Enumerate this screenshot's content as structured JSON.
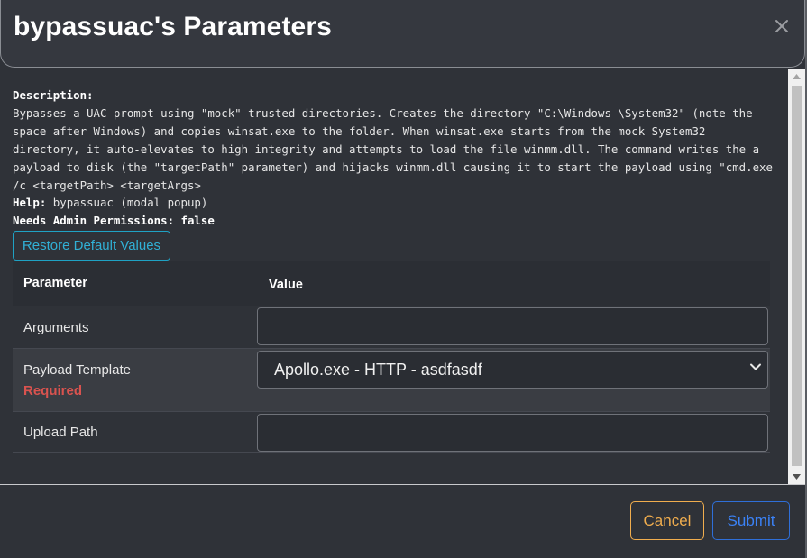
{
  "dialog": {
    "title": "bypassuac's Parameters",
    "close_icon": "close-icon"
  },
  "description": {
    "label": "Description:",
    "text": "Bypasses a UAC prompt using \"mock\" trusted directories. Creates the directory \"C:\\Windows \\System32\" (note the space after Windows) and copies winsat.exe to the folder. When winsat.exe starts from the mock System32 directory, it auto-elevates to high integrity and attempts to load the file winmm.dll. The command writes the a payload to disk (the \"targetPath\" parameter) and hijacks winmm.dll causing it to start the payload using \"cmd.exe /c <targetPath> <targetArgs>",
    "help_label": "Help:",
    "help_text": "bypassuac (modal popup)",
    "admin_label": "Needs Admin Permissions:",
    "admin_value": "false"
  },
  "restore_button": "Restore Default Values",
  "table": {
    "headers": [
      "Parameter",
      "Value"
    ],
    "rows": [
      {
        "name": "Arguments",
        "value": "",
        "required": ""
      },
      {
        "name": "Payload Template",
        "value": "Apollo.exe - HTTP - asdfasdf",
        "required": "Required"
      },
      {
        "name": "Upload Path",
        "value": "",
        "required": ""
      }
    ]
  },
  "footer": {
    "cancel": "Cancel",
    "submit": "Submit"
  },
  "colors": {
    "required": "#d9534f",
    "restore": "#31b0d5",
    "cancel": "#f0ad4e",
    "submit": "#3b82f6"
  }
}
